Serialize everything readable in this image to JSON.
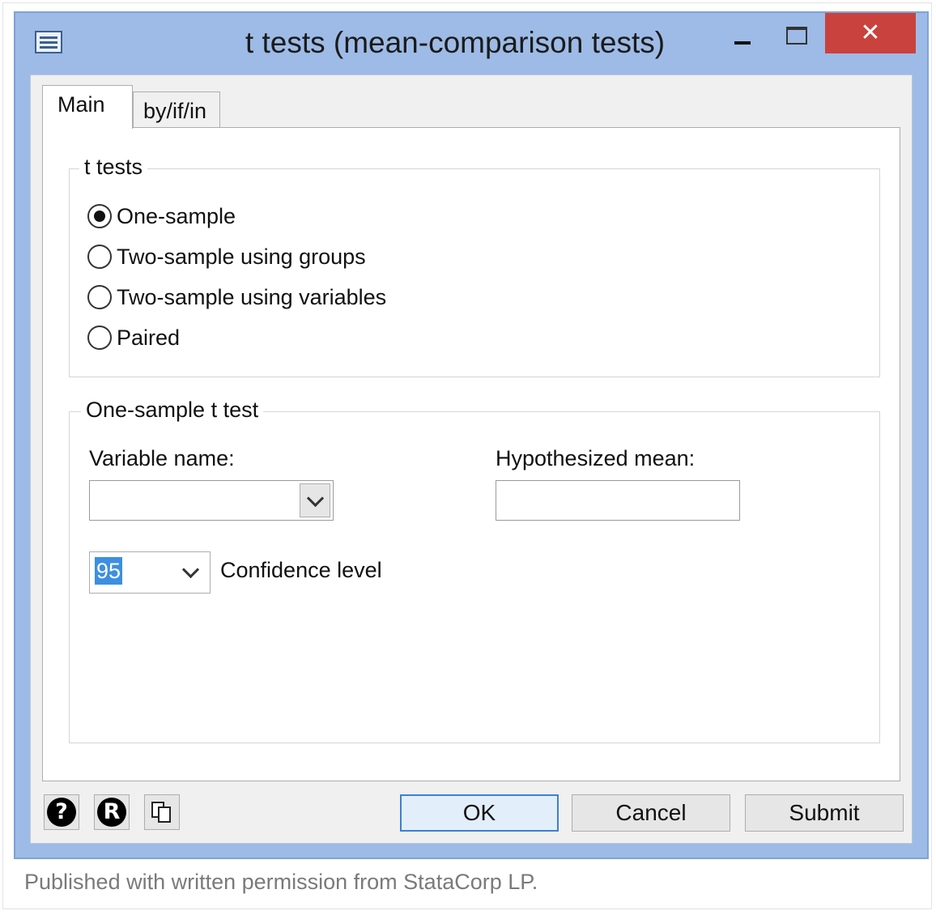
{
  "window": {
    "title": "t tests (mean-comparison tests)",
    "close_glyph": "✕",
    "accent_color": "#9dbbe6"
  },
  "tabs": [
    {
      "label": "Main",
      "active": true
    },
    {
      "label": "by/if/in",
      "active": false
    }
  ],
  "t_tests_group": {
    "legend": "t tests",
    "options": [
      {
        "label": "One-sample",
        "checked": true
      },
      {
        "label": "Two-sample using groups",
        "checked": false
      },
      {
        "label": "Two-sample using variables",
        "checked": false
      },
      {
        "label": "Paired",
        "checked": false
      }
    ]
  },
  "one_sample_group": {
    "legend": "One-sample t test",
    "variable_name_label": "Variable name:",
    "variable_name_value": "",
    "hypothesized_mean_label": "Hypothesized mean:",
    "hypothesized_mean_value": "",
    "confidence_value": "95",
    "confidence_label": "Confidence level"
  },
  "footer": {
    "help_icon": "?",
    "reset_icon": "R",
    "ok_label": "OK",
    "cancel_label": "Cancel",
    "submit_label": "Submit"
  },
  "caption": "Published with written permission from StataCorp LP."
}
